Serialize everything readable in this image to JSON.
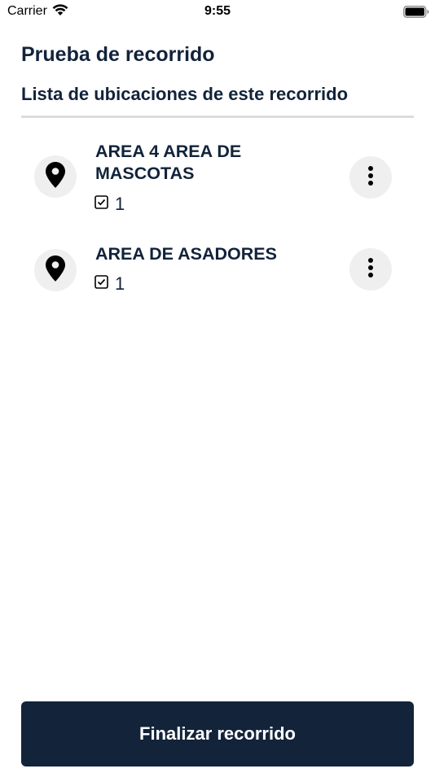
{
  "status_bar": {
    "carrier": "Carrier",
    "time": "9:55",
    "icons": [
      "wifi-icon",
      "battery-icon"
    ]
  },
  "header": {
    "title": "Prueba de recorrido",
    "subtitle": "Lista de ubicaciones de este recorrido"
  },
  "locations": [
    {
      "name": "AREA 4 AREA DE MASCOTAS",
      "count": "1",
      "icon": "map-pin-icon",
      "menu_icon": "more-vertical-icon",
      "check_icon": "checkbox-checked-icon"
    },
    {
      "name": "AREA DE ASADORES",
      "count": "1",
      "icon": "map-pin-icon",
      "menu_icon": "more-vertical-icon",
      "check_icon": "checkbox-checked-icon"
    }
  ],
  "footer": {
    "finish_label": "Finalizar recorrido"
  },
  "colors": {
    "primary": "#12233a",
    "circle_bg": "#efefef",
    "divider": "#dcdcdc"
  }
}
